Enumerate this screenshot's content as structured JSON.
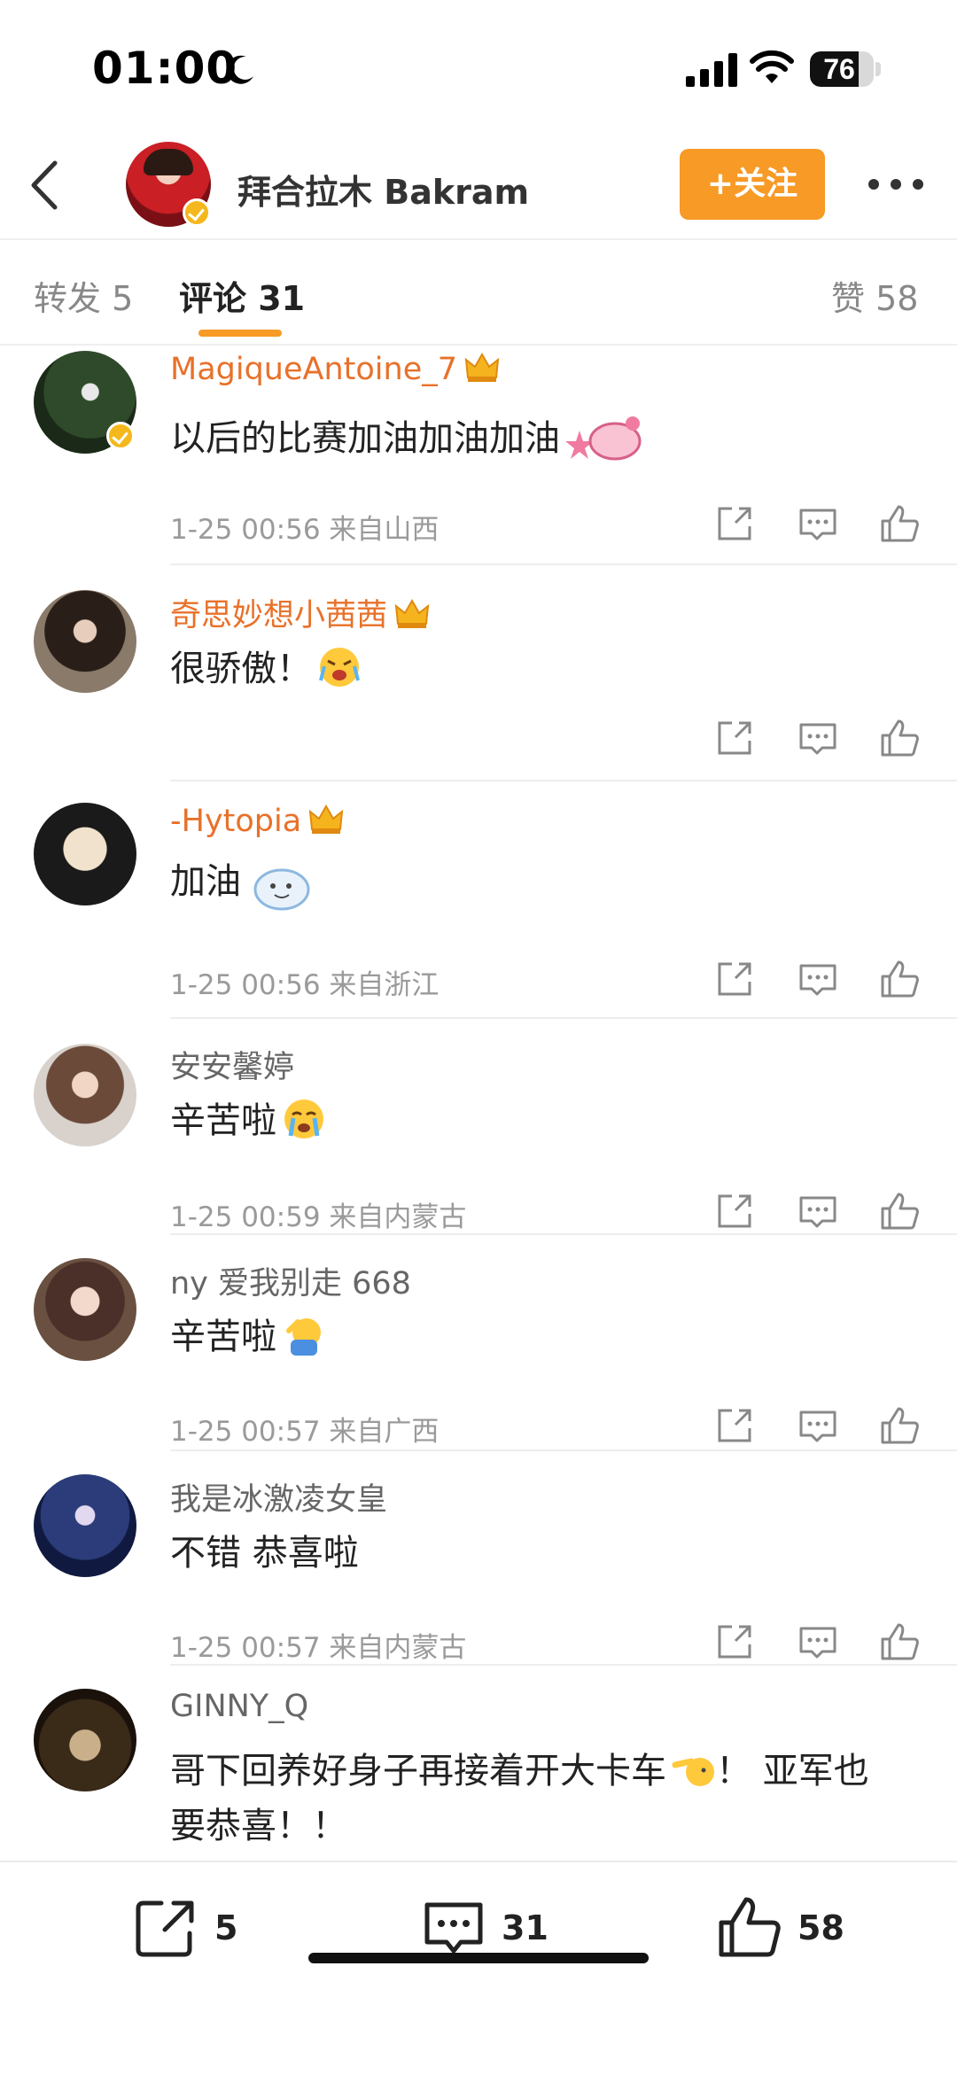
{
  "status_bar": {
    "time": "01:00",
    "battery": "76",
    "battery_level": 0.76
  },
  "header": {
    "user_name": "拜合拉木 Bakram",
    "follow_label": "+关注"
  },
  "tabs": {
    "repost": "转发 5",
    "comments": "评论 31",
    "likes": "赞 58"
  },
  "comments": [
    {
      "name": "MagiqueAntoine_7",
      "vip": true,
      "text": "以后的比赛加油加油加油",
      "meta": "1-25 00:56 来自山西"
    },
    {
      "name": "奇思妙想小茜茜",
      "vip": true,
      "text": "很骄傲！",
      "meta": ""
    },
    {
      "name": "-Hytopia",
      "vip": true,
      "text": "加油",
      "meta": "1-25 00:56 来自浙江"
    },
    {
      "name": "安安馨婷",
      "vip": false,
      "text": "辛苦啦",
      "meta": "1-25 00:59 来自内蒙古"
    },
    {
      "name": "ny 爱我别走 668",
      "vip": false,
      "text": "辛苦啦",
      "meta": "1-25 00:57 来自广西"
    },
    {
      "name": "我是冰激凌女皇",
      "vip": false,
      "text": "不错 恭喜啦",
      "meta": "1-25 00:57 来自内蒙古"
    },
    {
      "name": "GINNY_Q",
      "vip": false,
      "text_line1": "哥下回养好身子再接着开大卡车",
      "text_line1b": "！ 亚军也",
      "text_line2": "要恭喜！！"
    }
  ],
  "bottom_bar": {
    "repost_count": "5",
    "comment_count": "31",
    "like_count": "58"
  },
  "colors": {
    "accent": "#f79a26",
    "vip_name": "#e8712a",
    "meta": "#9a9a9a"
  },
  "icons": [
    "back-arrow-icon",
    "moon-icon",
    "signal-icon",
    "wifi-icon",
    "battery-icon",
    "verified-icon",
    "crown-icon",
    "share-icon",
    "comment-icon",
    "like-icon",
    "more-icon"
  ]
}
